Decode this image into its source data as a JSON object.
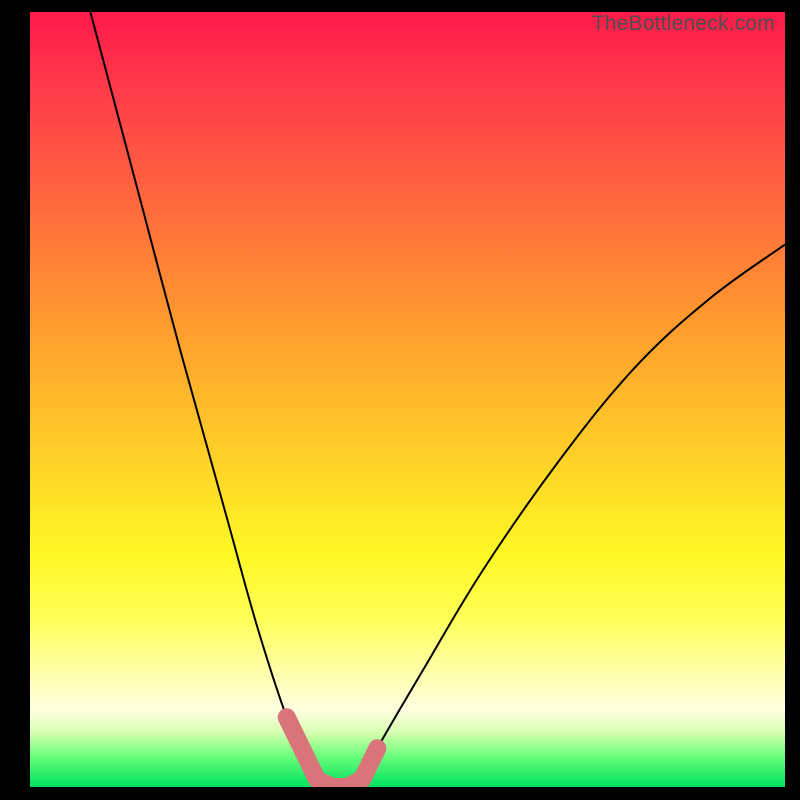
{
  "watermark": "TheBottleneck.com",
  "colors": {
    "background": "#000000",
    "gradient_top": "#ff1a4a",
    "gradient_bottom": "#00e060",
    "curve": "#000000",
    "marker": "#d9757a"
  },
  "chart_data": {
    "type": "line",
    "title": "",
    "xlabel": "",
    "ylabel": "",
    "xlim": [
      0,
      100
    ],
    "ylim": [
      0,
      100
    ],
    "series": [
      {
        "name": "bottleneck-curve",
        "x": [
          8,
          14,
          20,
          26,
          30,
          34,
          36,
          38,
          40,
          42,
          44,
          46,
          52,
          60,
          70,
          80,
          90,
          100
        ],
        "y": [
          100,
          78,
          56,
          35,
          21,
          9,
          5,
          1,
          0,
          0,
          1,
          5,
          15,
          28,
          42,
          54,
          63,
          70
        ]
      }
    ],
    "marker_region": {
      "x": [
        34,
        36,
        38,
        40,
        42,
        44,
        46
      ],
      "y": [
        9,
        5,
        1,
        0,
        0,
        1,
        5
      ]
    }
  }
}
